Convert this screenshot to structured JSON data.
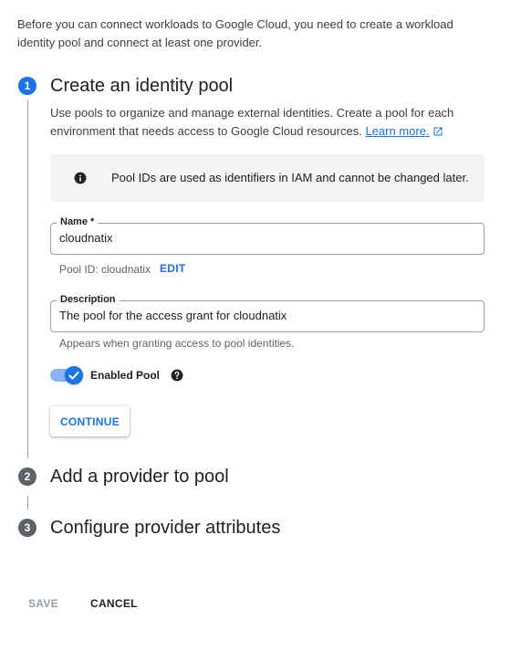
{
  "intro_text": "Before you can connect workloads to Google Cloud, you need to create a workload identity pool and connect at least one provider.",
  "steps": [
    {
      "number": "1",
      "title": "Create an identity pool"
    },
    {
      "number": "2",
      "title": "Add a provider to pool"
    },
    {
      "number": "3",
      "title": "Configure provider attributes"
    }
  ],
  "step1": {
    "description": "Use pools to organize and manage external identities. Create a pool for each environment that needs access to Google Cloud resources.",
    "learn_more": "Learn more.",
    "info_text": "Pool IDs are used as identifiers in IAM and cannot be changed later.",
    "name_field": {
      "label": "Name *",
      "value": "cloudnatix"
    },
    "pool_id_text": "Pool ID: cloudnatix",
    "edit_label": "EDIT",
    "description_field": {
      "label": "Description",
      "value": "The pool for the access grant for cloudnatix"
    },
    "description_hint": "Appears when granting access to pool identities.",
    "enabled_label": "Enabled Pool",
    "continue_label": "CONTINUE"
  },
  "footer": {
    "save_label": "SAVE",
    "cancel_label": "CANCEL"
  },
  "colors": {
    "accent": "#1a73e8",
    "step_inactive": "#5f6368",
    "info_bg": "#f1f3f4"
  }
}
